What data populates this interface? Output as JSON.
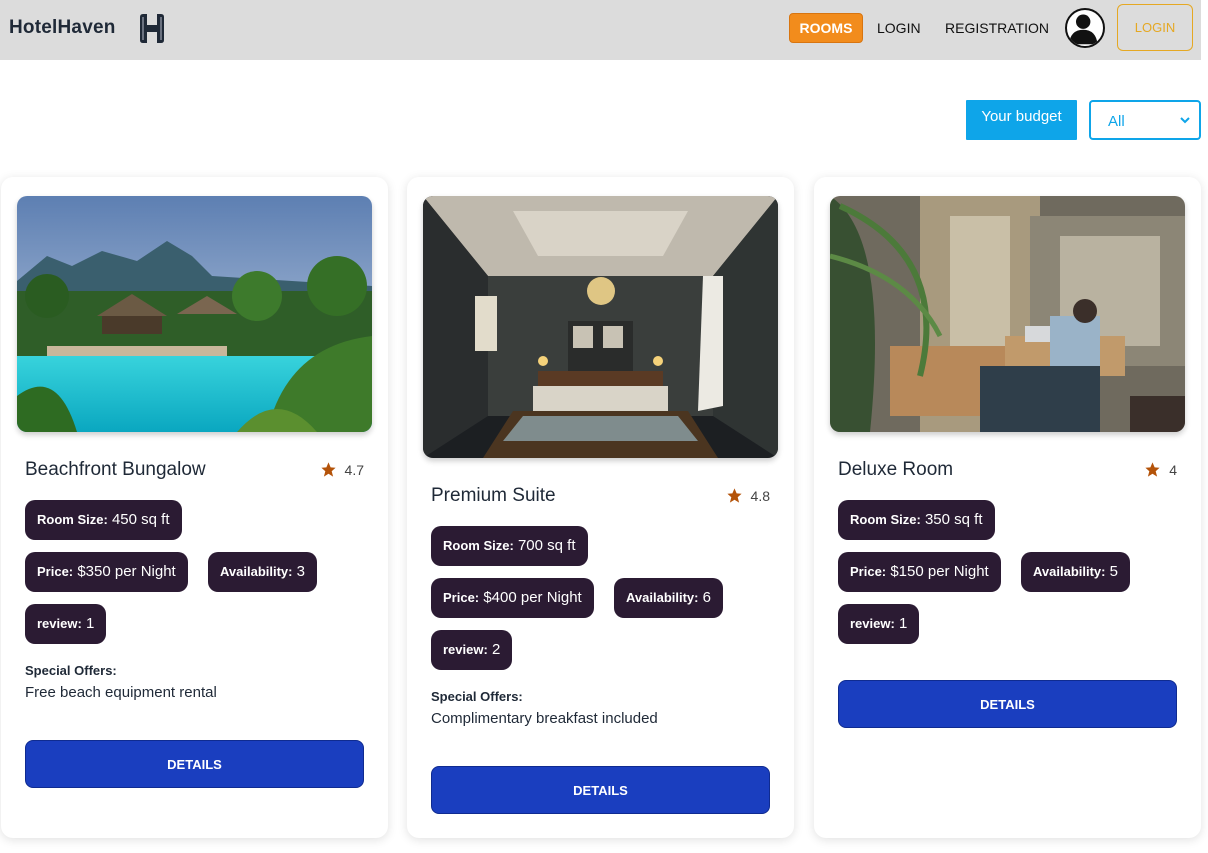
{
  "navbar": {
    "brand": "HotelHaven",
    "links": {
      "rooms": "ROOMS",
      "login": "LOGIN",
      "registration": "REGISTRATION"
    },
    "login_button": "LOGIN",
    "accent": "#f28c1c",
    "login_accent": "#e5a823"
  },
  "filter": {
    "label": "Your budget",
    "select_value": "All",
    "accent": "#0ea5e9"
  },
  "rooms": [
    {
      "name": "Beachfront Bungalow",
      "rating": "4.7",
      "room_size_label": "Room Size:",
      "room_size": "450 sq ft",
      "price_label": "Price:",
      "price": "$350 per Night",
      "availability_label": "Availability:",
      "availability": "3",
      "review_label": "review:",
      "review": "1",
      "offers_heading": "Special Offers:",
      "offers": "Free beach equipment rental",
      "details_label": "DETAILS"
    },
    {
      "name": "Premium Suite",
      "rating": "4.8",
      "room_size_label": "Room Size:",
      "room_size": "700 sq ft",
      "price_label": "Price:",
      "price": "$400 per Night",
      "availability_label": "Availability:",
      "availability": "6",
      "review_label": "review:",
      "review": "2",
      "offers_heading": "Special Offers:",
      "offers": "Complimentary breakfast included",
      "details_label": "DETAILS"
    },
    {
      "name": "Deluxe Room",
      "rating": "4",
      "room_size_label": "Room Size:",
      "room_size": "350 sq ft",
      "price_label": "Price:",
      "price": "$150 per Night",
      "availability_label": "Availability:",
      "availability": "5",
      "review_label": "review:",
      "review": "1",
      "details_label": "DETAILS"
    }
  ],
  "icons": {
    "logo": "hotel-logo-icon",
    "avatar": "user-avatar-icon",
    "star": "star-icon",
    "chevron": "chevron-down-icon"
  },
  "colors": {
    "pill_bg": "#2b1b33",
    "button_bg": "#1a3ebf",
    "star": "#b45309"
  }
}
